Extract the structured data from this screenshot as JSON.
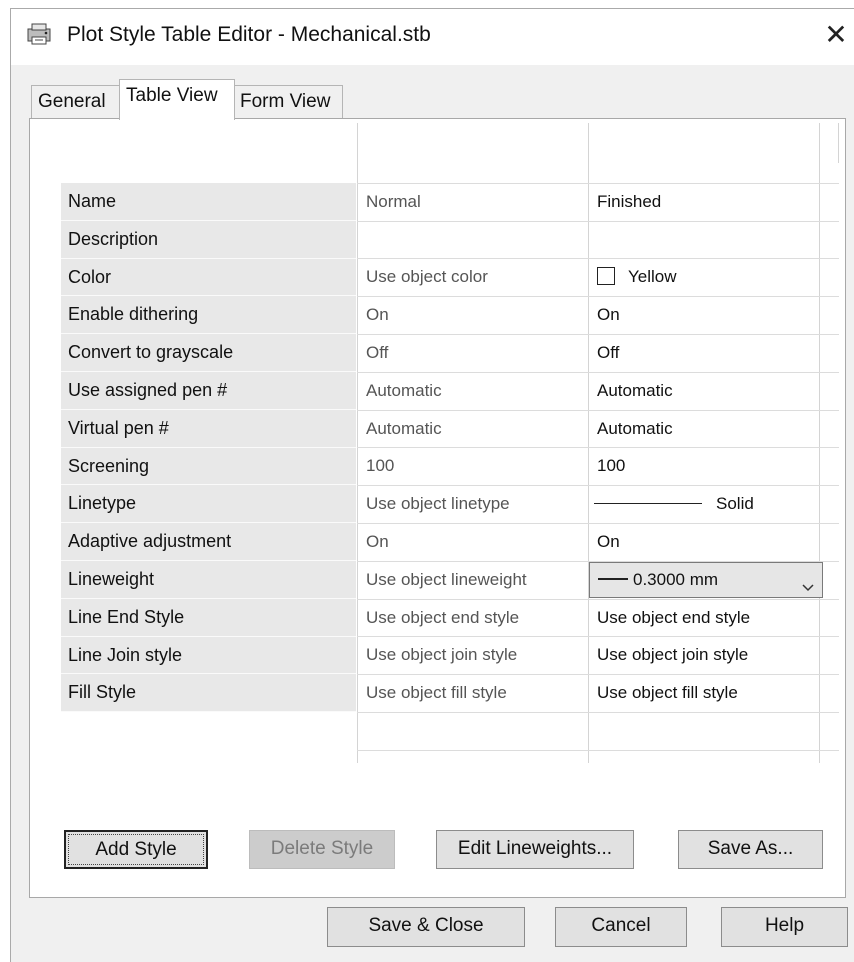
{
  "window": {
    "title": "Plot Style Table Editor - Mechanical.stb",
    "close_symbol": "✕",
    "app_icon": "plot-style-table-icon"
  },
  "tabs": [
    {
      "label": "General",
      "active": false
    },
    {
      "label": "Table View",
      "active": true
    },
    {
      "label": "Form View",
      "active": false
    }
  ],
  "properties": [
    {
      "label": "Name",
      "normal": "Normal",
      "finished": "Finished"
    },
    {
      "label": "Description",
      "normal": "",
      "finished": ""
    },
    {
      "label": "Color",
      "normal": "Use object color",
      "finished": "Yellow"
    },
    {
      "label": "Enable dithering",
      "normal": "On",
      "finished": "On"
    },
    {
      "label": "Convert to grayscale",
      "normal": "Off",
      "finished": "Off"
    },
    {
      "label": "Use assigned pen #",
      "normal": "Automatic",
      "finished": "Automatic"
    },
    {
      "label": "Virtual pen #",
      "normal": "Automatic",
      "finished": "Automatic"
    },
    {
      "label": "Screening",
      "normal": "100",
      "finished": "100"
    },
    {
      "label": "Linetype",
      "normal": "Use object linetype",
      "finished": "Solid"
    },
    {
      "label": "Adaptive adjustment",
      "normal": "On",
      "finished": "On"
    },
    {
      "label": "Lineweight",
      "normal": "Use object lineweight",
      "finished": "0.3000 mm"
    },
    {
      "label": "Line End Style",
      "normal": "Use object end style",
      "finished": "Use object end style"
    },
    {
      "label": "Line Join style",
      "normal": "Use object join style",
      "finished": "Use object join style"
    },
    {
      "label": "Fill Style",
      "normal": "Use object fill style",
      "finished": "Use object fill style"
    }
  ],
  "panel_buttons": {
    "add_style": "Add Style",
    "delete_style": "Delete Style",
    "edit_lineweights": "Edit Lineweights...",
    "save_as": "Save As..."
  },
  "footer_buttons": {
    "save_close": "Save & Close",
    "cancel": "Cancel",
    "help": "Help"
  },
  "colors": {
    "finished_swatch": "#ffffff",
    "window_bg": "#f0f0f0",
    "label_bg": "#e8e8e8"
  }
}
